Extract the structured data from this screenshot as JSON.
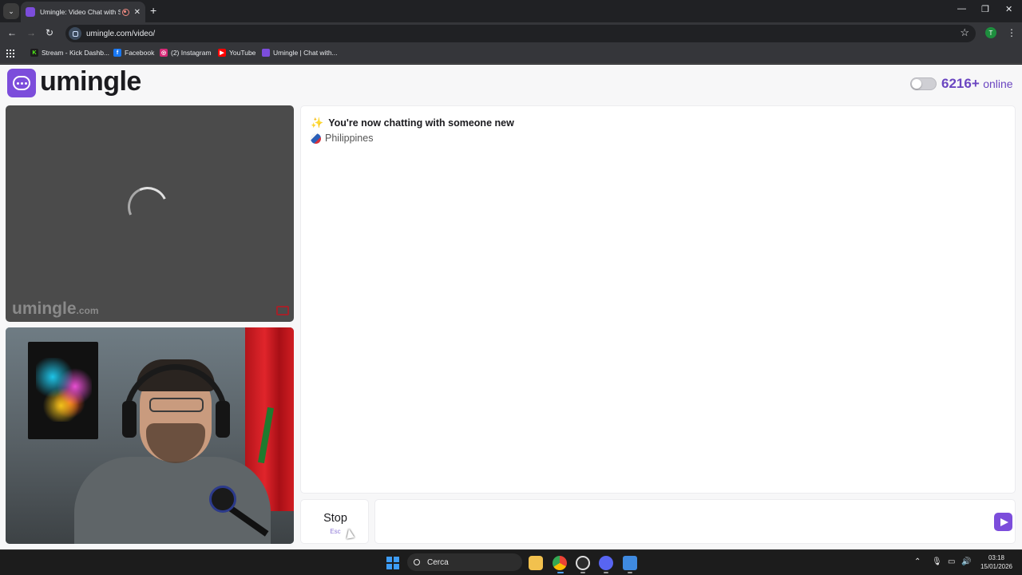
{
  "browser": {
    "tab_title": "Umingle: Video Chat with S",
    "tab_close": "✕",
    "new_tab": "+",
    "url": "umingle.com/video/",
    "bookmarks": [
      {
        "label": "Stream - Kick Dashb...",
        "icon": "kick-icon",
        "glyph": "K",
        "color": "#1d1d1d",
        "fg": "#53fc18"
      },
      {
        "label": "Facebook",
        "icon": "facebook-icon",
        "glyph": "f",
        "color": "#1877f2",
        "fg": "#ffffff"
      },
      {
        "label": "(2) Instagram",
        "icon": "instagram-icon",
        "glyph": "◎",
        "color": "#d62976",
        "fg": "#ffffff"
      },
      {
        "label": "YouTube",
        "icon": "youtube-icon",
        "glyph": "▶",
        "color": "#ff0000",
        "fg": "#ffffff"
      },
      {
        "label": "Umingle | Chat with...",
        "icon": "umingle-icon",
        "glyph": "",
        "color": "#7c4ddb",
        "fg": "#ffffff"
      }
    ],
    "profile_initial": "T"
  },
  "page": {
    "logo_text": "umingle",
    "online_count": "6216+",
    "online_label": "online",
    "watermark_main": "umingle",
    "watermark_suffix": ".com"
  },
  "chat": {
    "status_message": "You're now chatting with someone new",
    "partner_country": "Philippines",
    "stop_label": "Stop",
    "stop_hint": "Esc",
    "input_value": "",
    "input_placeholder": ""
  },
  "taskbar": {
    "search_label": "Cerca",
    "time": "03:18",
    "date": "15/01/2026"
  },
  "colors": {
    "accent": "#7c4ddb",
    "online_text": "#6b46c1"
  }
}
